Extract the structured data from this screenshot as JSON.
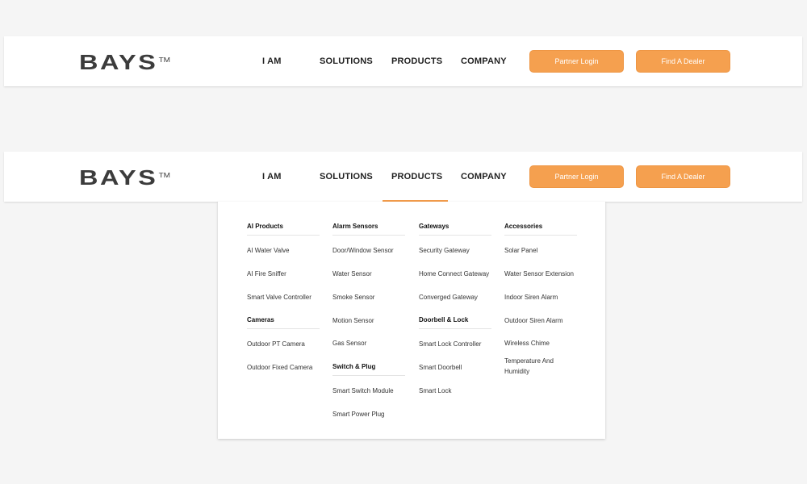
{
  "logo": {
    "text": "BAYS",
    "tm": "TM"
  },
  "nav": {
    "links": [
      "I AM",
      "SOLUTIONS",
      "PRODUCTS",
      "COMPANY"
    ],
    "active": "PRODUCTS",
    "partner_login": "Partner Login",
    "find_dealer": "Find A Dealer"
  },
  "colors": {
    "accent": "#f5a04f",
    "background": "#f5f5f5",
    "text": "#222222"
  },
  "menu": {
    "col1": {
      "h1": "AI Products",
      "items1": [
        "AI Water Valve",
        "AI Fire Sniffer",
        "Smart Valve Controller"
      ],
      "h2": "Cameras",
      "items2": [
        "Outdoor PT Camera",
        "Outdoor Fixed Camera"
      ]
    },
    "col2": {
      "h1": "Alarm Sensors",
      "items1": [
        "Door/Window Sensor",
        "Water Sensor",
        "Smoke Sensor",
        "Motion Sensor",
        "Gas Sensor"
      ],
      "h2": "Switch & Plug",
      "items2": [
        "Smart Switch Module",
        "Smart Power Plug"
      ]
    },
    "col3": {
      "h1": "Gateways",
      "items1": [
        "Security Gateway",
        "Home Connect Gateway",
        "Converged Gateway"
      ],
      "h2": "Doorbell & Lock",
      "items2": [
        "Smart Lock Controller",
        "Smart Doorbell",
        "Smart Lock"
      ]
    },
    "col4": {
      "h1": "Accessories",
      "items1": [
        "Solar Panel",
        "Water Sensor Extension",
        "Indoor Siren Alarm",
        "Outdoor Siren Alarm",
        "Wireless Chime",
        "Temperature And Humidity"
      ]
    }
  }
}
